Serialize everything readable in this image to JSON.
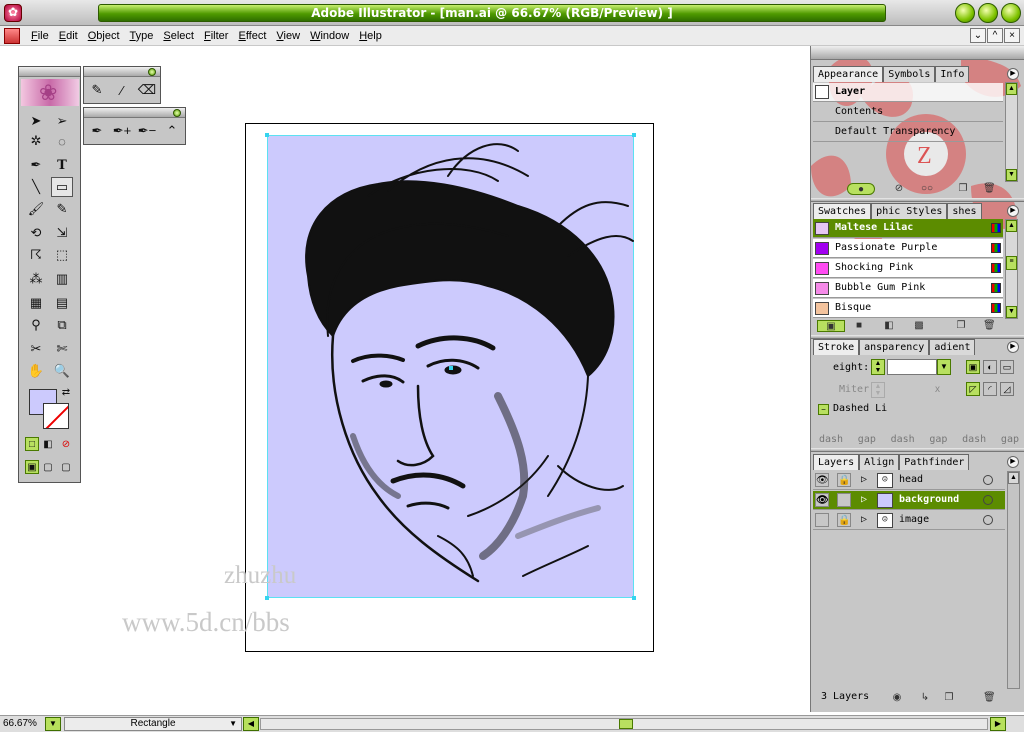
{
  "window": {
    "title": "Adobe Illustrator - [man.ai @ 66.67% (RGB/Preview) ]"
  },
  "menu": [
    "File",
    "Edit",
    "Object",
    "Type",
    "Select",
    "Filter",
    "Effect",
    "View",
    "Window",
    "Help"
  ],
  "watermarks": {
    "line1": "zhuzhu",
    "line2": "www.5d.cn/bbs"
  },
  "colors": {
    "accent": "#5c8c00",
    "artwork_fill": "#cccafd",
    "selection": "#35d4ee"
  },
  "appearance_panel": {
    "tabs": [
      "Appearance",
      "Symbols",
      "Info"
    ],
    "rows": [
      "Layer",
      "Contents",
      "Default Transparency"
    ]
  },
  "swatches_panel": {
    "tabs": [
      "Swatches",
      "phic Styles",
      "shes"
    ],
    "items": [
      {
        "name": "Maltese Lilac",
        "color": "#e6c7f4"
      },
      {
        "name": "Passionate Purple",
        "color": "#a200f0"
      },
      {
        "name": "Shocking Pink",
        "color": "#ff4cf2"
      },
      {
        "name": "Bubble Gum Pink",
        "color": "#f58ae8"
      },
      {
        "name": "Bisque",
        "color": "#f3c39d"
      }
    ]
  },
  "stroke_panel": {
    "tabs": [
      "Stroke",
      "ansparency",
      "adient"
    ],
    "weight_label": "eight:",
    "miter_label": "Miter",
    "miter_unit": "x",
    "dashed_label": "Dashed Li",
    "dash_labels": [
      "dash",
      "gap",
      "dash",
      "gap",
      "dash",
      "gap"
    ]
  },
  "layers_panel": {
    "tabs": [
      "Layers",
      "Align",
      "Pathfinder"
    ],
    "layers": [
      {
        "name": "head",
        "visible": true,
        "locked": true
      },
      {
        "name": "background",
        "visible": true,
        "locked": false,
        "selected": true
      },
      {
        "name": "image",
        "visible": false,
        "locked": true
      }
    ],
    "count_label": "3 Layers"
  },
  "status": {
    "zoom": "66.67%",
    "tool": "Rectangle"
  }
}
